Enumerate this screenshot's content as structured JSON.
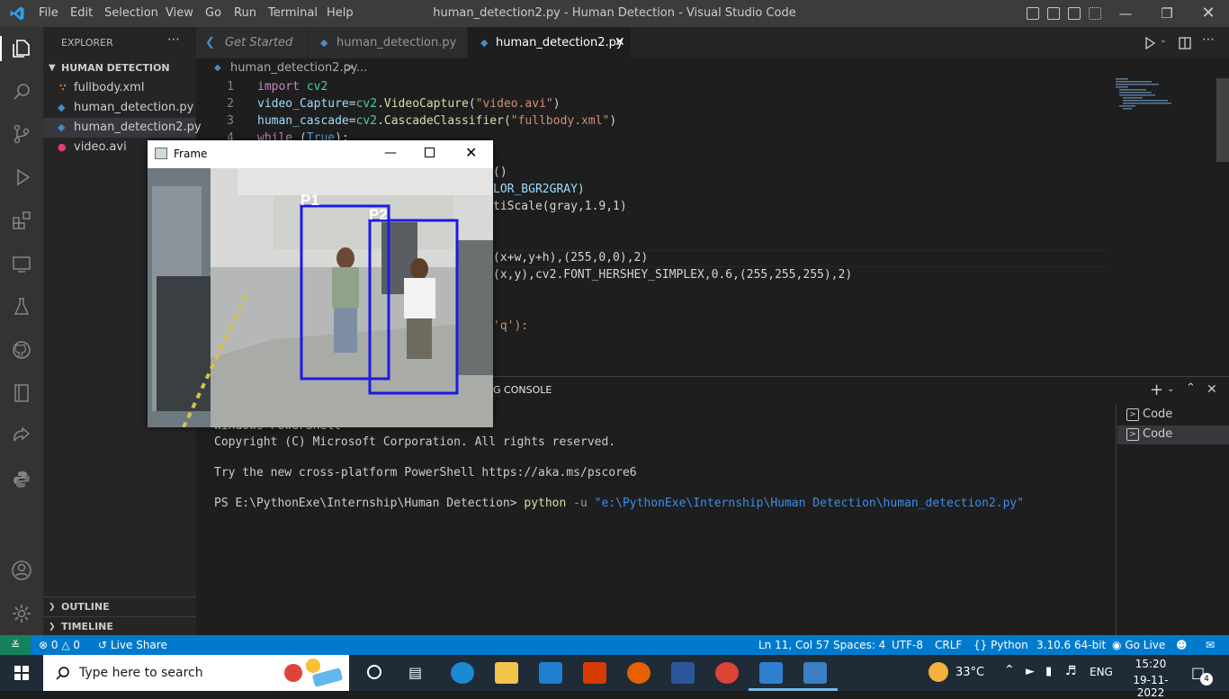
{
  "titlebar": {
    "title": "human_detection2.py - Human Detection - Visual Studio Code",
    "menu": [
      "File",
      "Edit",
      "Selection",
      "View",
      "Go",
      "Run",
      "Terminal",
      "Help"
    ]
  },
  "sidebar": {
    "header": "EXPLORER",
    "folder": "HUMAN DETECTION",
    "files": [
      "fullbody.xml",
      "human_detection.py",
      "human_detection2.py",
      "video.avi"
    ],
    "outline": "OUTLINE",
    "timeline": "TIMELINE"
  },
  "tabs": [
    {
      "label": "Get Started"
    },
    {
      "label": "human_detection.py"
    },
    {
      "label": "human_detection2.py"
    }
  ],
  "breadcrumb": {
    "file": "human_detection2.py",
    "sep": ">",
    "more": "..."
  },
  "editor": {
    "line_numbers": [
      "1",
      "2",
      "3",
      "4"
    ],
    "lines": [
      "import cv2",
      "video_Capture=cv2.VideoCapture(\"video.avi\")",
      "human_cascade=cv2.CascadeClassifier(\"fullbody.xml\")",
      "while (True):"
    ],
    "fragments": [
      "()",
      "LOR_BGR2GRAY)",
      "tiScale(gray,1.9,1)",
      "(x+w,y+h),(255,0,0),2)",
      "(x,y),cv2.FONT_HERSHEY_SIMPLEX,0.6,(255,255,255),2)",
      "'q'):"
    ]
  },
  "panel": {
    "tab_partial": "G CONSOLE",
    "terminals": [
      "Code",
      "Code"
    ],
    "lines": [
      "Windows PowerShell",
      "Copyright (C) Microsoft Corporation. All rights reserved.",
      "",
      "Try the new cross-platform PowerShell https://aka.ms/pscore6",
      ""
    ],
    "prompt": "PS E:\\PythonExe\\Internship\\Human Detection>",
    "cmd": "python",
    "flag": "-u",
    "path": "\"e:\\PythonExe\\Internship\\Human Detection\\human_detection2.py\""
  },
  "frame_window": {
    "title": "Frame",
    "labels": [
      "P1",
      "P2"
    ]
  },
  "statusbar": {
    "errors": "0",
    "warnings": "0",
    "live_share": "Live Share",
    "position": "Ln 11, Col 57",
    "spaces": "Spaces: 4",
    "encoding": "UTF-8",
    "eol": "CRLF",
    "language": "Python",
    "interpreter": "3.10.6 64-bit",
    "go_live": "Go Live"
  },
  "taskbar": {
    "search_placeholder": "Type here to search",
    "temperature": "33°C",
    "lang": "ENG",
    "time": "15:20",
    "date": "19-11-2022",
    "notif_count": "4"
  },
  "colors": {
    "accent": "#007acc",
    "keyword": "#c586c0",
    "string": "#ce9178",
    "variable": "#9cdcfe",
    "function": "#dcdcaa",
    "module": "#4ec9b0",
    "number": "#b5cea8",
    "detection_box": "#1a1ae6"
  }
}
